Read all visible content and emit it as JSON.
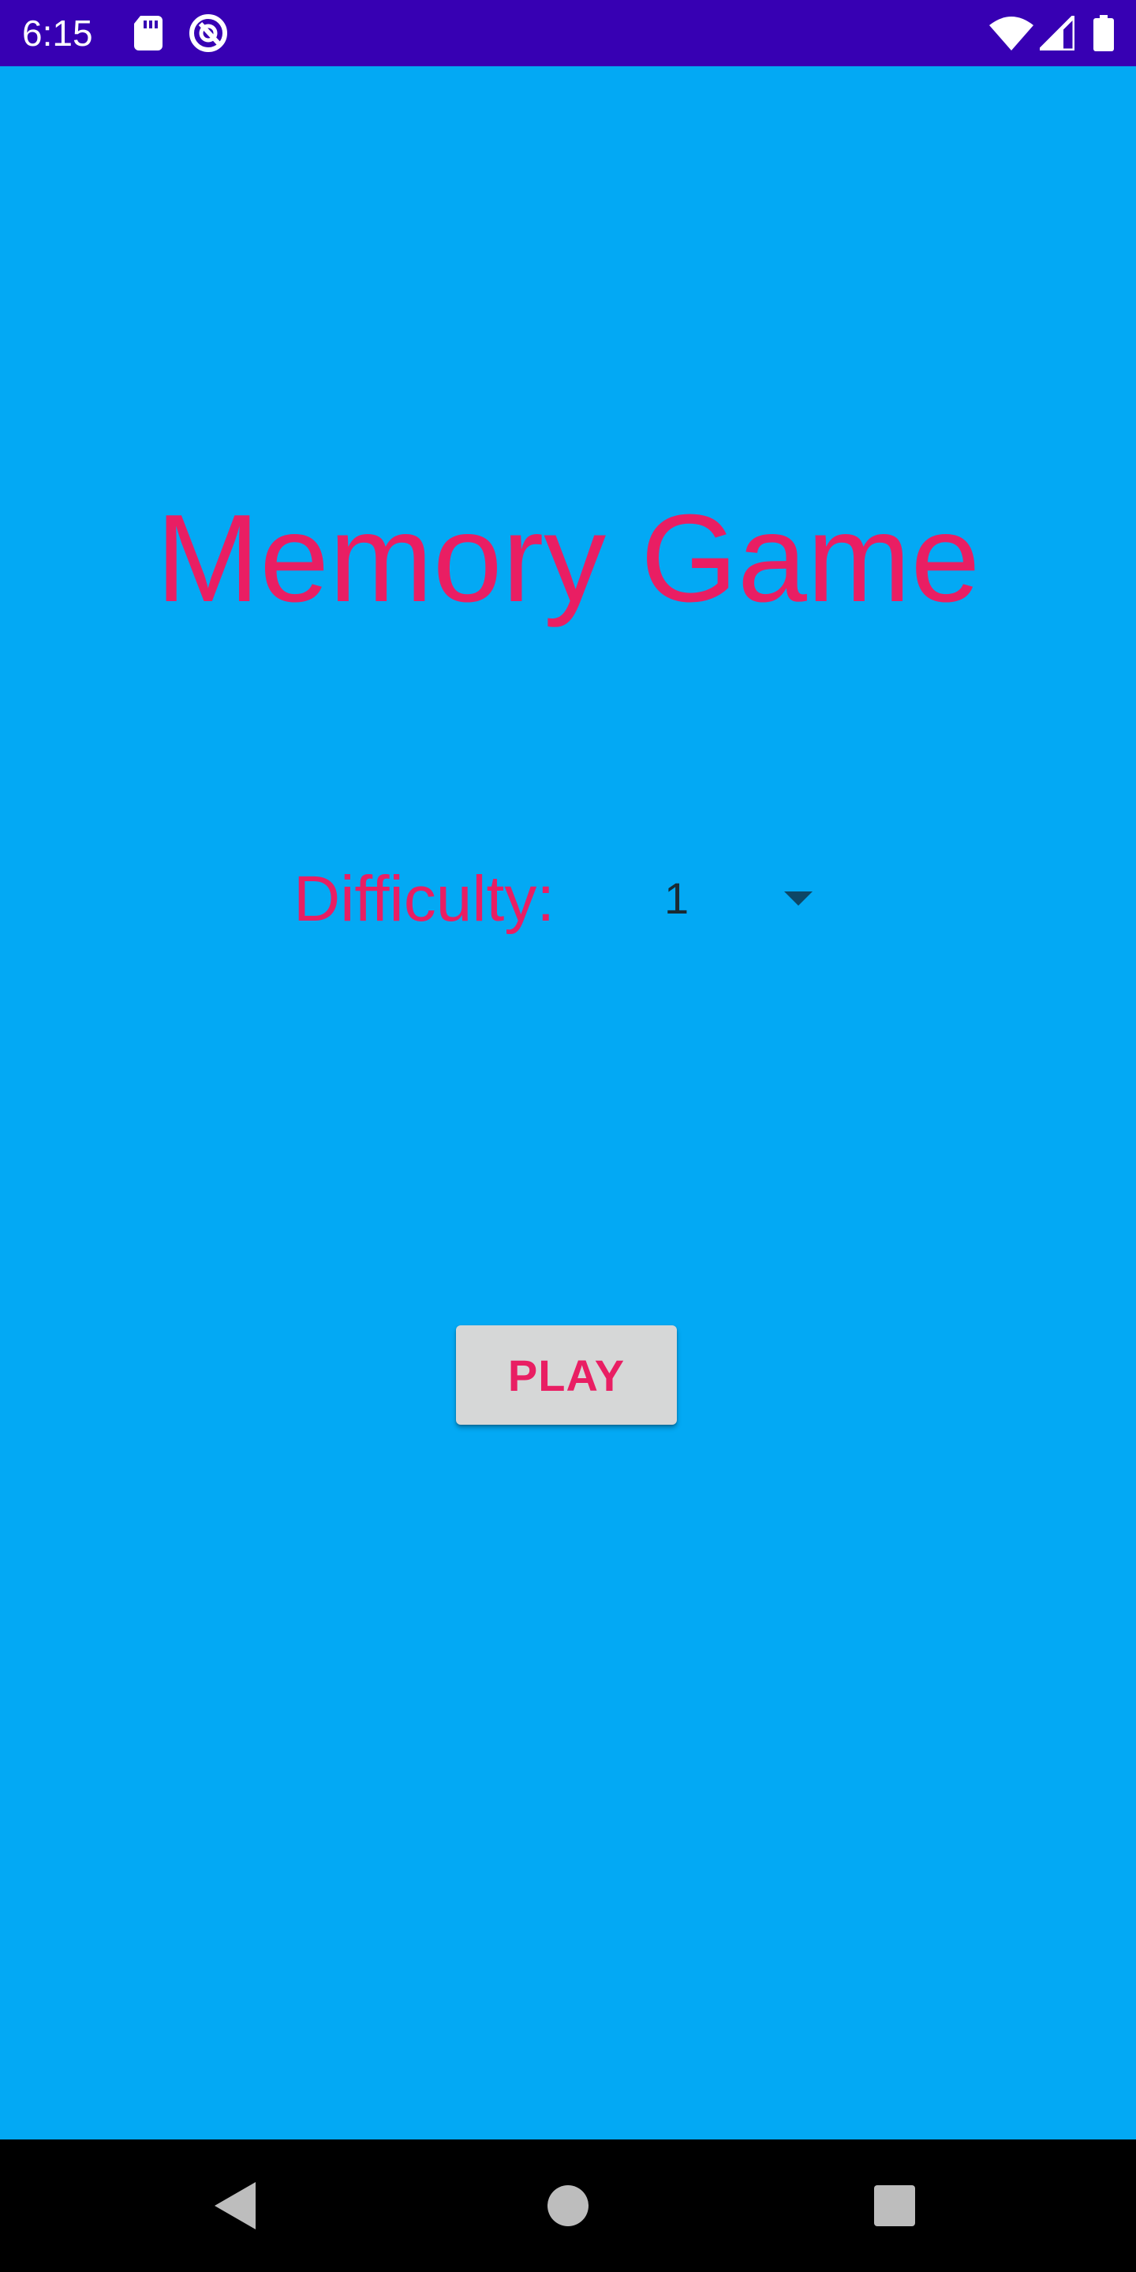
{
  "status_bar": {
    "time": "6:15",
    "background_color": "#3700B3",
    "icons": [
      "sd-card-icon",
      "sync-icon",
      "wifi-icon",
      "signal-icon",
      "battery-icon"
    ]
  },
  "app": {
    "background_color": "#03A9F4",
    "accent_color": "#E91E63"
  },
  "main": {
    "title": "Memory Game",
    "difficulty_label": "Difficulty:",
    "difficulty_selected": "1",
    "play_button_label": "PLAY"
  },
  "nav_bar": {
    "icons": [
      "back-icon",
      "home-icon",
      "recents-icon"
    ]
  }
}
